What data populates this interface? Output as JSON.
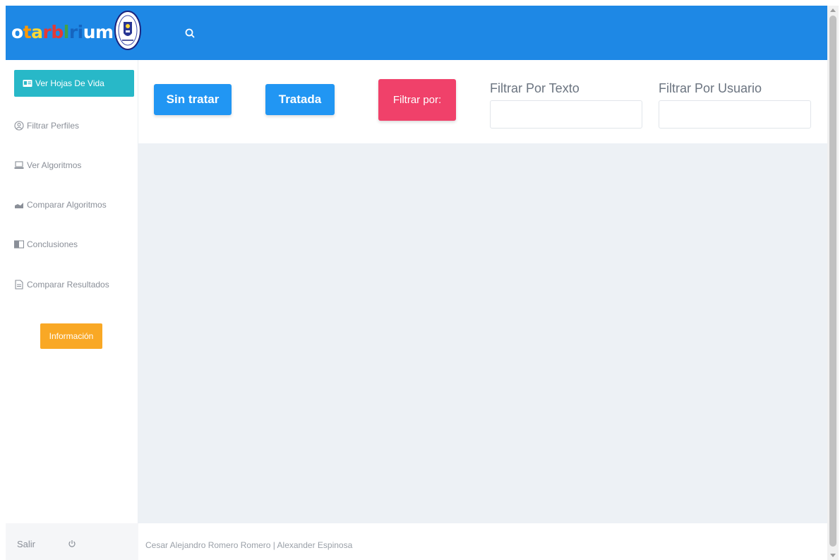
{
  "header": {
    "logo_parts": [
      "o ",
      "t",
      "a",
      "rb",
      "l",
      "ri",
      "um"
    ],
    "logo_colors": {
      "white": "#ffffff",
      "orange": "#ff9800",
      "yellow": "#fdd835",
      "red": "#e53935",
      "green": "#43a047",
      "blue": "#1565c0"
    },
    "background_color": "#1e88e5",
    "search_icon": "search-icon"
  },
  "sidebar": {
    "items": [
      {
        "label": "Ver Hojas De Vida",
        "icon": "id-card-icon",
        "active": true
      },
      {
        "label": "Filtrar Perfiles",
        "icon": "user-circle-icon",
        "active": false
      },
      {
        "label": "Ver Algoritmos",
        "icon": "laptop-icon",
        "active": false
      },
      {
        "label": "Comparar Algoritmos",
        "icon": "chart-icon",
        "active": false
      },
      {
        "label": "Conclusiones",
        "icon": "columns-icon",
        "active": false
      },
      {
        "label": "Comparar Resultados",
        "icon": "document-icon",
        "active": false
      }
    ],
    "info_button": "Información",
    "active_color": "#28b8c8",
    "info_color": "#f9a825"
  },
  "sidebar_footer": {
    "logout_label": "Salir",
    "power_icon": "power-icon"
  },
  "filters": {
    "sin_tratar": "Sin tratar",
    "tratada": "Tratada",
    "filtrar_por": "Filtrar por:",
    "text_label": "Filtrar Por Texto",
    "text_value": "",
    "user_label": "Filtrar Por Usuario",
    "user_value": "",
    "button_blue": "#2196f3",
    "button_pink": "#f0416a"
  },
  "footer": {
    "credits": "Cesar Alejandro Romero Romero | Alexander Espinosa"
  }
}
